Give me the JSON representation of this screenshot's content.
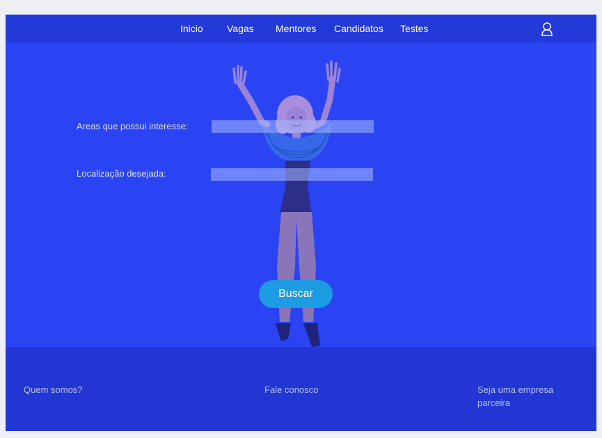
{
  "nav": {
    "items": [
      {
        "label": "Inicio"
      },
      {
        "label": "Vagas"
      },
      {
        "label": "Mentores"
      },
      {
        "label": "Candidatos"
      },
      {
        "label": "Testes"
      }
    ],
    "user_icon": "user-icon"
  },
  "form": {
    "areas_label": "Areas que possui interesse:",
    "areas_value": "",
    "location_label": "Localização desejada:",
    "location_value": "",
    "search_button": "Buscar"
  },
  "footer": {
    "about": "Quem somos?",
    "contact": "Fale conosco",
    "partner_line1": "Seja  uma empresa",
    "partner_line2": "parceira"
  },
  "colors": {
    "background": "#2a44f4",
    "header": "#2339d8",
    "footer": "#2236d3",
    "button": "#1d9be3",
    "page": "#eef0f3"
  }
}
